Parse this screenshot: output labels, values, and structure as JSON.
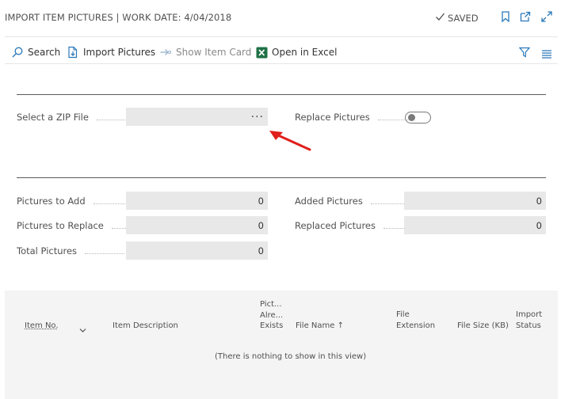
{
  "header": {
    "title": "IMPORT ITEM PICTURES | WORK DATE: 4/04/2018",
    "saved_label": "SAVED",
    "icons": [
      "checkmark-icon",
      "bookmark-icon",
      "open-new-window-icon",
      "expand-icon"
    ]
  },
  "toolbar": {
    "search_label": "Search",
    "import_pictures_label": "Import Pictures",
    "show_item_card_label": "Show Item Card",
    "open_in_excel_label": "Open in Excel",
    "icons": [
      "search-icon",
      "import-pictures-icon",
      "show-item-card-icon",
      "excel-icon",
      "filter-icon",
      "list-view-icon"
    ]
  },
  "form": {
    "zip_file_label": "Select a ZIP File",
    "zip_file_value": "",
    "assist_edit_label": "···",
    "replace_pictures_label": "Replace Pictures",
    "replace_pictures_on": false
  },
  "stats": {
    "pictures_to_add_label": "Pictures to Add",
    "pictures_to_add_value": "0",
    "pictures_to_replace_label": "Pictures to Replace",
    "pictures_to_replace_value": "0",
    "total_pictures_label": "Total Pictures",
    "total_pictures_value": "0",
    "added_pictures_label": "Added Pictures",
    "added_pictures_value": "0",
    "replaced_pictures_label": "Replaced Pictures",
    "replaced_pictures_value": "0"
  },
  "grid": {
    "columns": {
      "item_no": "Item No.",
      "item_description": "Item Description",
      "pict_line1": "Pict...",
      "pict_line2": "Alre...",
      "pict_line3": "Exists",
      "file_name": "File Name ↑",
      "file_ext_line1": "File",
      "file_ext_line2": "Extension",
      "file_size": "File Size (KB)",
      "import_status_line1": "Import",
      "import_status_line2": "Status"
    },
    "empty_text": "(There is nothing to show in this view)"
  },
  "colors": {
    "annotation_arrow": "#e0201b",
    "excel_green": "#1e7145",
    "field_background": "#e8e8e8",
    "grid_background": "#f4f4f4"
  }
}
